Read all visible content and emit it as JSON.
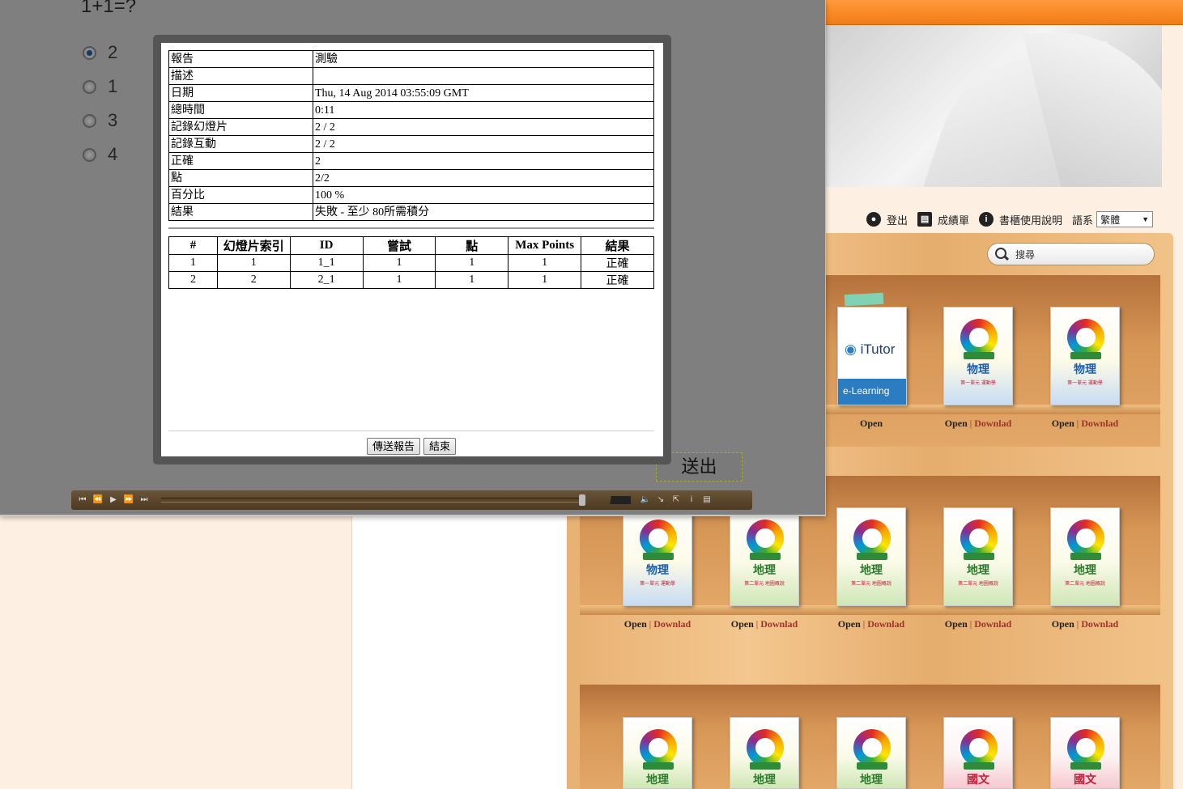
{
  "quiz": {
    "question": "1+1=?",
    "options": [
      "2",
      "1",
      "3",
      "4"
    ],
    "selected_index": 0,
    "submit_label": "送出"
  },
  "report": {
    "rows": [
      {
        "label": "報告",
        "value": "測驗"
      },
      {
        "label": "描述",
        "value": ""
      },
      {
        "label": "日期",
        "value": "Thu, 14 Aug 2014 03:55:09 GMT"
      },
      {
        "label": "總時間",
        "value": "0:11"
      },
      {
        "label": "記錄幻燈片",
        "value": "2 / 2"
      },
      {
        "label": "記錄互動",
        "value": "2 / 2"
      },
      {
        "label": "正確",
        "value": "2"
      },
      {
        "label": "點",
        "value": "2/2"
      },
      {
        "label": "百分比",
        "value": "100 %"
      },
      {
        "label": "結果",
        "value": "失敗 - 至少 80所需積分"
      }
    ],
    "detail_headers": [
      "#",
      "幻燈片索引",
      "ID",
      "嘗試",
      "點",
      "Max Points",
      "結果"
    ],
    "detail_rows": [
      [
        "1",
        "1",
        "1_1",
        "1",
        "1",
        "1",
        "正確"
      ],
      [
        "2",
        "2",
        "2_1",
        "1",
        "1",
        "1",
        "正確"
      ]
    ],
    "send_button": "傳送報告",
    "end_button": "結束"
  },
  "header": {
    "logout": "登出",
    "grades": "成績單",
    "help": "書櫃使用說明",
    "lang_label": "語系",
    "lang_value": "繁體"
  },
  "search": {
    "placeholder": "搜尋"
  },
  "itutor": {
    "name": "iTutor",
    "tagline": "e-Learning",
    "open": "Open"
  },
  "book_links": {
    "open": "Open",
    "sep": "|",
    "download": "Downlad"
  },
  "books": [
    {
      "subject": "物理",
      "sub": "第一單元 運動學",
      "theme": "blue"
    },
    {
      "subject": "物理",
      "sub": "第一單元 運動學",
      "theme": "blue"
    },
    {
      "subject": "物理",
      "sub": "第一單元 運動學",
      "theme": "blue"
    },
    {
      "subject": "地理",
      "sub": "第二單元 地圖概說",
      "theme": "green"
    },
    {
      "subject": "地理",
      "sub": "第二單元 地圖概說",
      "theme": "green"
    },
    {
      "subject": "地理",
      "sub": "第二單元 地圖概說",
      "theme": "green"
    },
    {
      "subject": "地理",
      "sub": "第二單元 地圖概說",
      "theme": "green"
    },
    {
      "subject": "地理",
      "sub": "",
      "theme": "green"
    },
    {
      "subject": "地理",
      "sub": "",
      "theme": "green"
    },
    {
      "subject": "地理",
      "sub": "",
      "theme": "green"
    },
    {
      "subject": "國文",
      "sub": "",
      "theme": "pink"
    },
    {
      "subject": "國文",
      "sub": "",
      "theme": "pink"
    }
  ]
}
